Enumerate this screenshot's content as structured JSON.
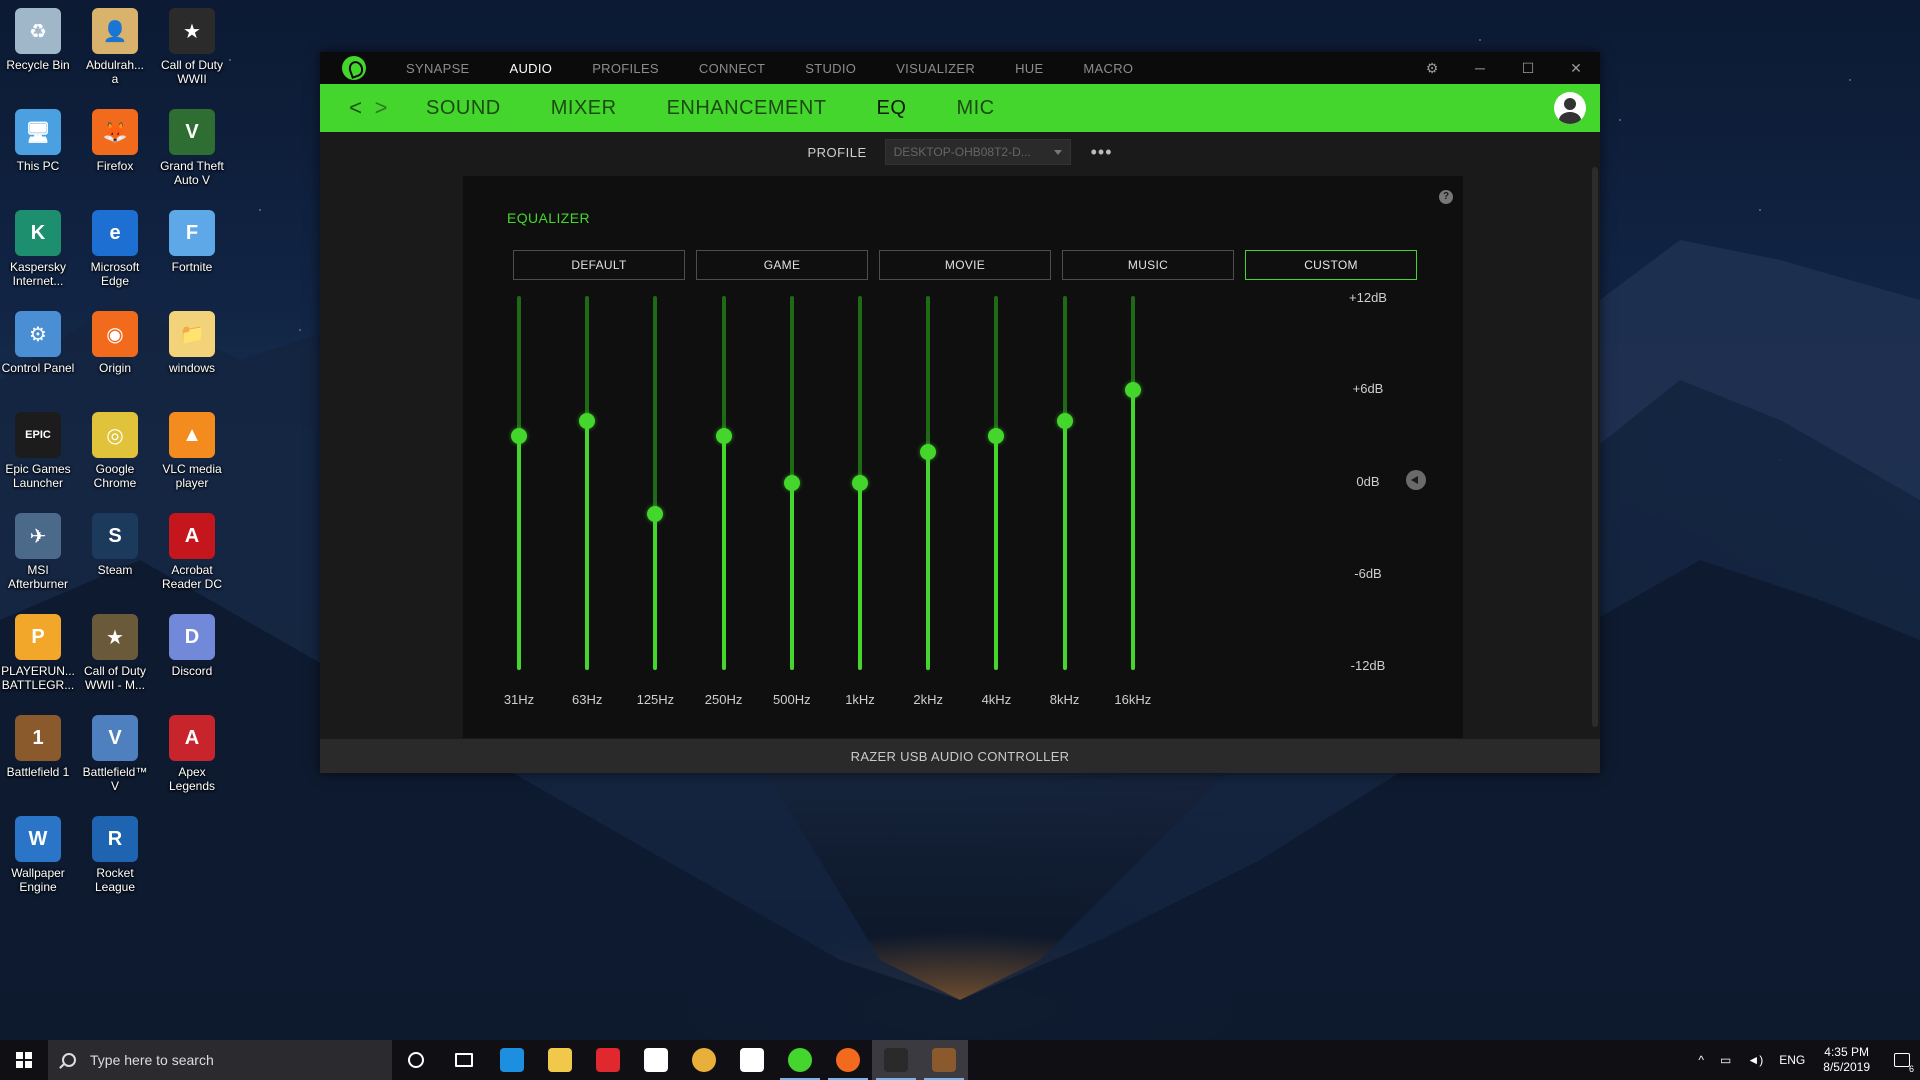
{
  "desktop": {
    "icons": [
      {
        "label": "Recycle Bin",
        "color": "#9fb7c9",
        "glyph": "♻"
      },
      {
        "label": "Abdulrah...\na",
        "color": "#d9b26b",
        "glyph": "👤"
      },
      {
        "label": "Call of Duty WWII",
        "color": "#2b2b2b",
        "glyph": "★"
      },
      {
        "label": "This PC",
        "color": "#4aa0e0",
        "glyph": "🖥"
      },
      {
        "label": "Firefox",
        "color": "#f26b1d",
        "glyph": "🦊"
      },
      {
        "label": "Grand Theft Auto V",
        "color": "#2f6e33",
        "glyph": "V"
      },
      {
        "label": "Kaspersky Internet...",
        "color": "#1d8f6f",
        "glyph": "K"
      },
      {
        "label": "Microsoft Edge",
        "color": "#1d6fd1",
        "glyph": "e"
      },
      {
        "label": "Fortnite",
        "color": "#5fa8e8",
        "glyph": "F"
      },
      {
        "label": "Control Panel",
        "color": "#4a8fd3",
        "glyph": "⚙"
      },
      {
        "label": "Origin",
        "color": "#f26a1c",
        "glyph": "◉"
      },
      {
        "label": "windows",
        "color": "#f3d37a",
        "glyph": "📁"
      },
      {
        "label": "Epic Games Launcher",
        "color": "#1c1c1c",
        "glyph": "EPIC"
      },
      {
        "label": "Google Chrome",
        "color": "#e0c33a",
        "glyph": "◎"
      },
      {
        "label": "VLC media player",
        "color": "#f48b1e",
        "glyph": "▲"
      },
      {
        "label": "MSI Afterburner",
        "color": "#4b6a8a",
        "glyph": "✈"
      },
      {
        "label": "Steam",
        "color": "#1b3a5c",
        "glyph": "S"
      },
      {
        "label": "Acrobat Reader DC",
        "color": "#c4161c",
        "glyph": "A"
      },
      {
        "label": "PLAYERUN... BATTLEGR...",
        "color": "#f2a72a",
        "glyph": "P"
      },
      {
        "label": "Call of Duty WWII - M...",
        "color": "#6b5a3a",
        "glyph": "★"
      },
      {
        "label": "Discord",
        "color": "#7289da",
        "glyph": "D"
      },
      {
        "label": "Battlefield 1",
        "color": "#8a5a2c",
        "glyph": "1"
      },
      {
        "label": "Battlefield™ V",
        "color": "#4e7fbf",
        "glyph": "V"
      },
      {
        "label": "Apex Legends",
        "color": "#c8242b",
        "glyph": "A"
      },
      {
        "label": "Wallpaper Engine",
        "color": "#2a75c7",
        "glyph": "W"
      },
      {
        "label": "Rocket League",
        "color": "#1e64b0",
        "glyph": "R"
      }
    ]
  },
  "app": {
    "topnav": [
      "SYNAPSE",
      "AUDIO",
      "PROFILES",
      "CONNECT",
      "STUDIO",
      "VISUALIZER",
      "HUE",
      "MACRO"
    ],
    "topnav_active": "AUDIO",
    "controls": {
      "settings": "⚙",
      "minimize": "─",
      "maximize": "☐",
      "close": "✕"
    },
    "back": "<",
    "forward": ">",
    "subtabs": [
      "SOUND",
      "MIXER",
      "ENHANCEMENT",
      "EQ",
      "MIC"
    ],
    "subtab_active": "EQ",
    "profile": {
      "label": "PROFILE",
      "value": "DESKTOP-OHB08T2-D...",
      "more": "•••"
    },
    "equalizer": {
      "title": "EQUALIZER",
      "help": "?",
      "presets": [
        "DEFAULT",
        "GAME",
        "MOVIE",
        "MUSIC",
        "CUSTOM"
      ],
      "active_preset": "CUSTOM",
      "db_range": [
        -12,
        12
      ],
      "db_labels": [
        "+12dB",
        "+6dB",
        "0dB",
        "-6dB",
        "-12dB"
      ],
      "bands": [
        {
          "freq": "31Hz",
          "gain_db": 3
        },
        {
          "freq": "63Hz",
          "gain_db": 4
        },
        {
          "freq": "125Hz",
          "gain_db": -2
        },
        {
          "freq": "250Hz",
          "gain_db": 3
        },
        {
          "freq": "500Hz",
          "gain_db": 0
        },
        {
          "freq": "1kHz",
          "gain_db": 0
        },
        {
          "freq": "2kHz",
          "gain_db": 2
        },
        {
          "freq": "4kHz",
          "gain_db": 3
        },
        {
          "freq": "8kHz",
          "gain_db": 4
        },
        {
          "freq": "16kHz",
          "gain_db": 6
        }
      ]
    },
    "footer": "RAZER USB AUDIO CONTROLLER",
    "accent": "#44d62c"
  },
  "taskbar": {
    "search_placeholder": "Type here to search",
    "apps": [
      {
        "name": "cortana",
        "color": "#ffffff"
      },
      {
        "name": "task-view",
        "color": "#ffffff"
      },
      {
        "name": "edge",
        "color": "#1d8fe0"
      },
      {
        "name": "file-explorer",
        "color": "#f2c84b"
      },
      {
        "name": "nodes-app",
        "color": "#e0282e"
      },
      {
        "name": "store",
        "color": "#ffffff"
      },
      {
        "name": "chrome",
        "color": "#e8b03a"
      },
      {
        "name": "mail",
        "color": "#ffffff"
      },
      {
        "name": "razer-synapse",
        "color": "#44d62c"
      },
      {
        "name": "origin",
        "color": "#f26a1c"
      },
      {
        "name": "epic-games",
        "color": "#2a2a2a"
      },
      {
        "name": "game",
        "color": "#8a5a2c"
      }
    ],
    "tray": {
      "lang": "ENG",
      "time": "4:35 PM",
      "date": "8/5/2019",
      "notif_count": "6"
    }
  }
}
